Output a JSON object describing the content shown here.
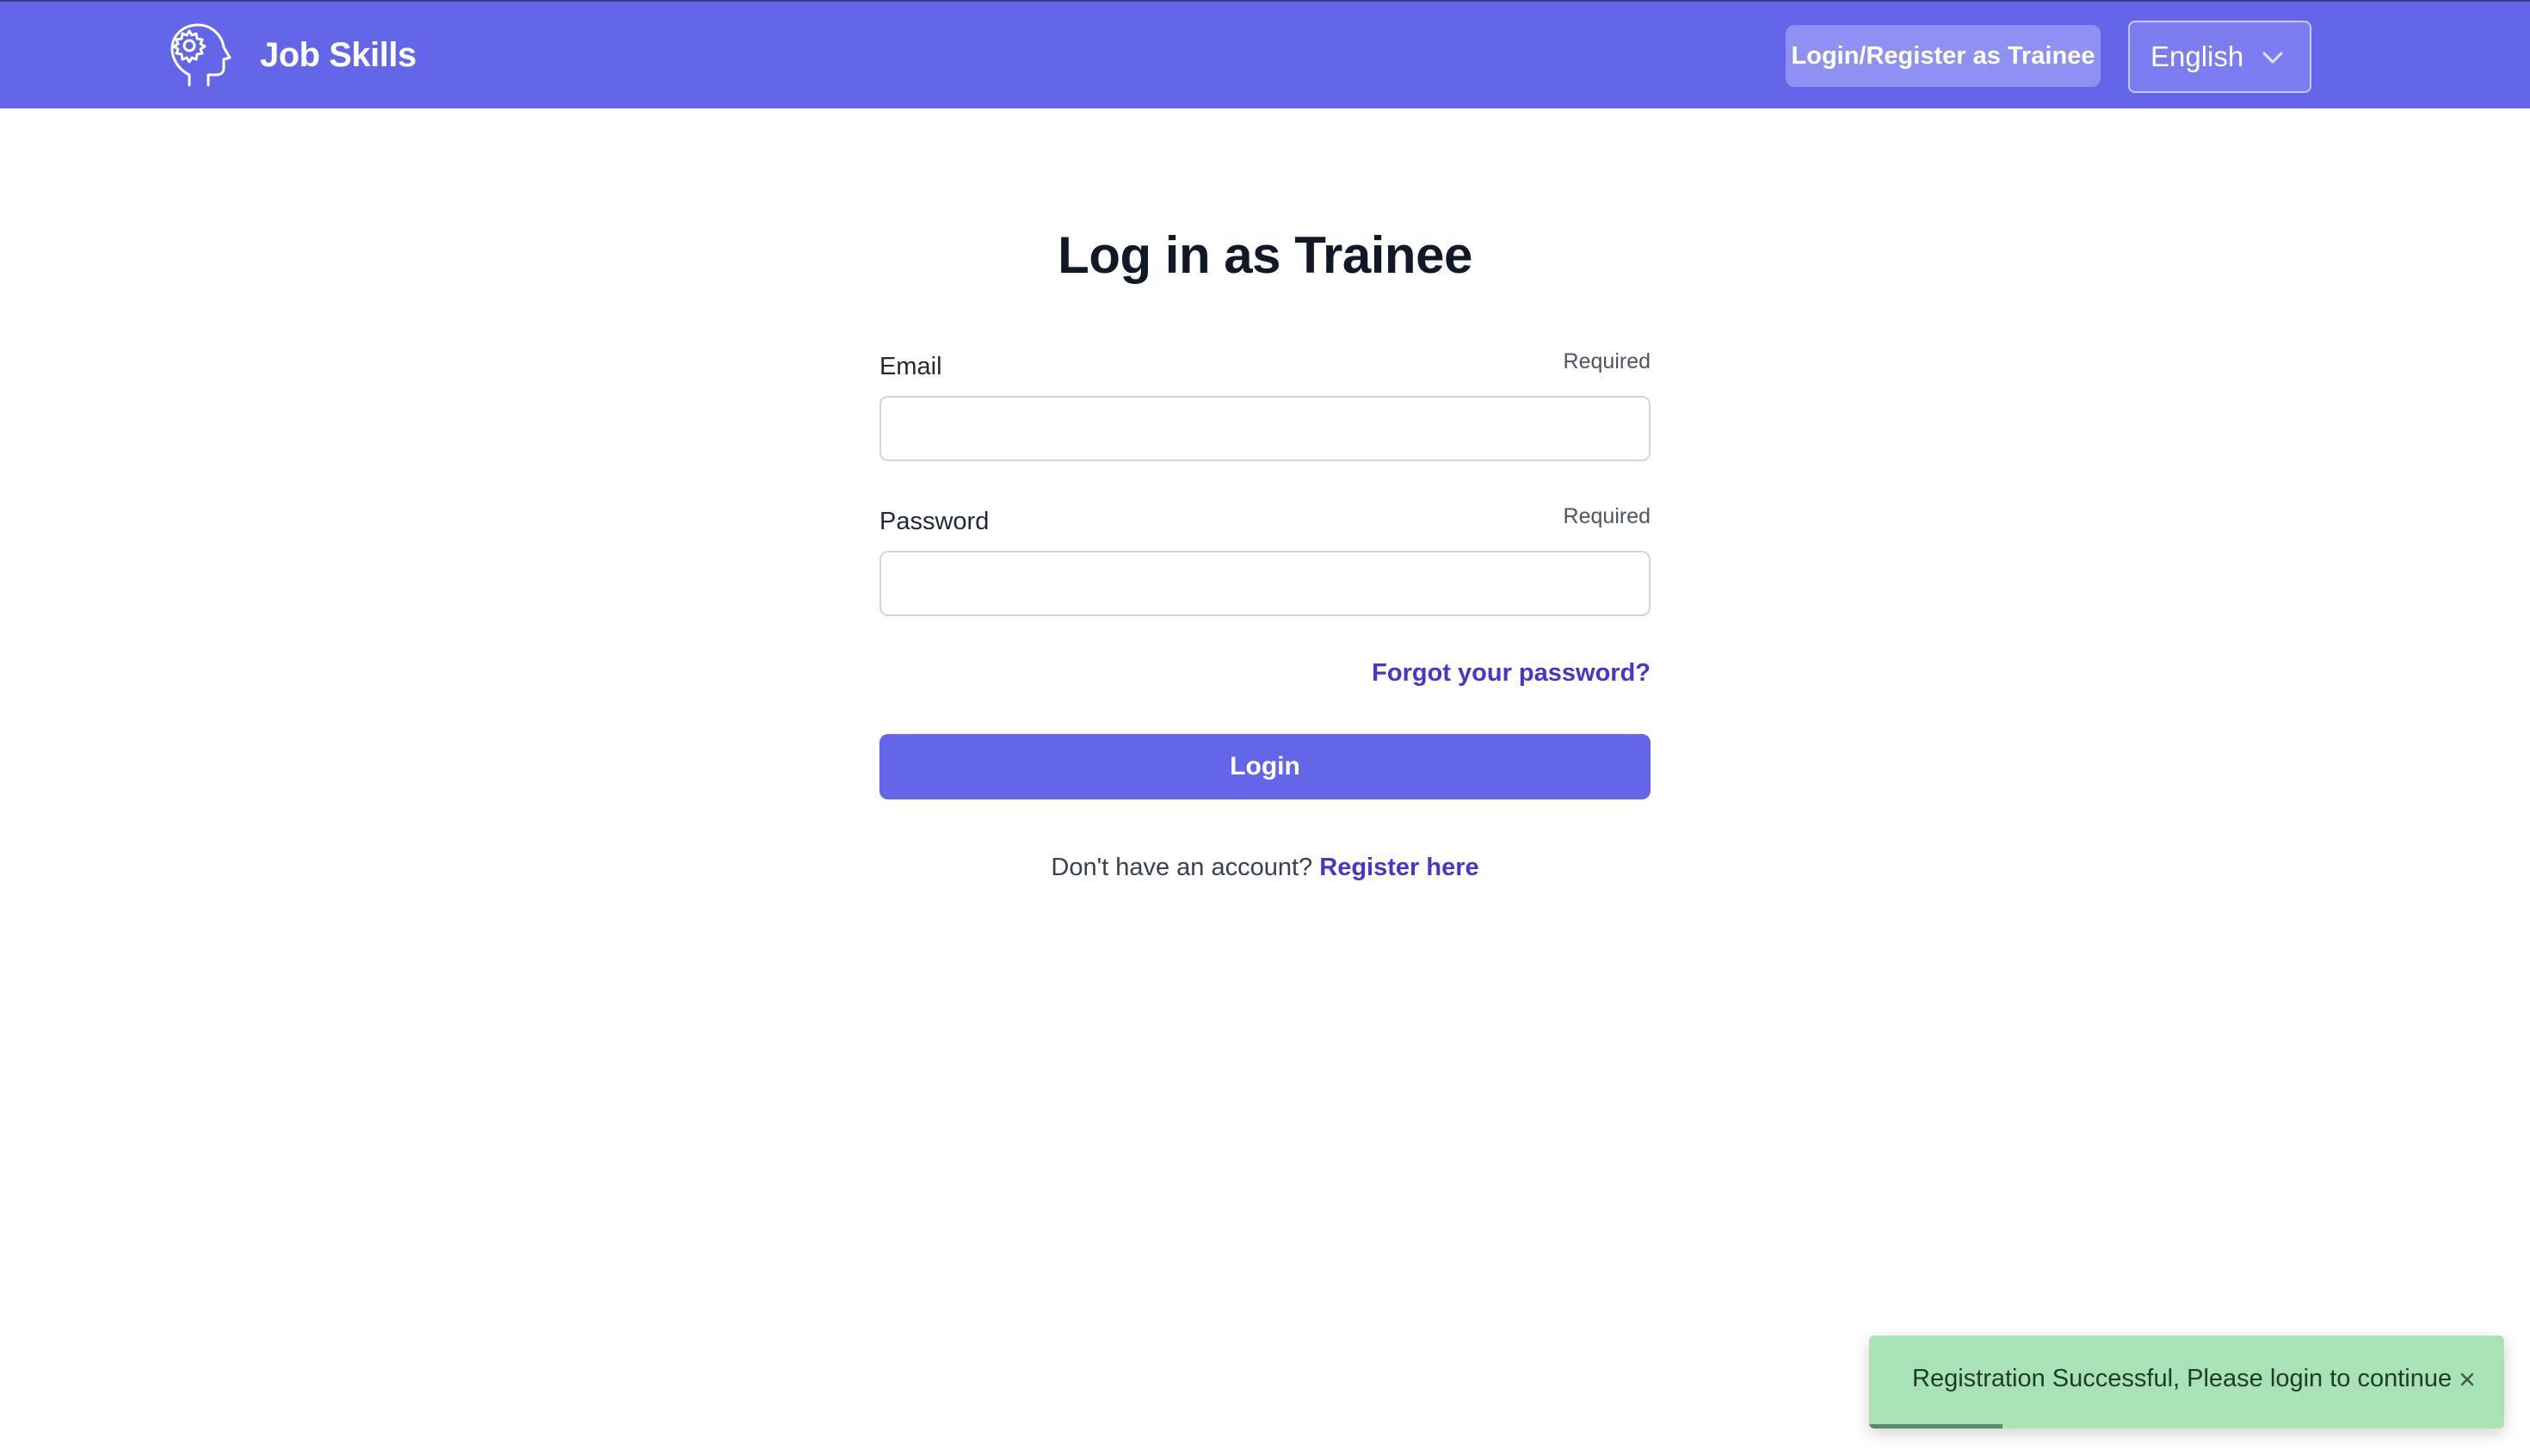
{
  "header": {
    "brand_name": "Job Skills",
    "brand_icon": "head-gear-icon",
    "trainee_button_label": "Login/Register as Trainee",
    "language": {
      "selected": "English",
      "icon": "chevron-down-icon"
    },
    "colors": {
      "bar": "#6366e9",
      "button": "#8f91f2"
    }
  },
  "main": {
    "title": "Log in as Trainee",
    "email": {
      "label": "Email",
      "required_text": "Required",
      "value": ""
    },
    "password": {
      "label": "Password",
      "required_text": "Required",
      "value": ""
    },
    "forgot_link": "Forgot your password?",
    "login_button": "Login",
    "register_prompt": "Don't have an account?",
    "register_link": "Register here",
    "colors": {
      "primary": "#6366e9",
      "link": "#4338ca"
    }
  },
  "toast": {
    "message": "Registration Successful, Please login to continue",
    "close_icon": "close-icon",
    "progress": 0.21,
    "colors": {
      "background": "#a9e2b5",
      "progress": "#5a8a66"
    }
  }
}
